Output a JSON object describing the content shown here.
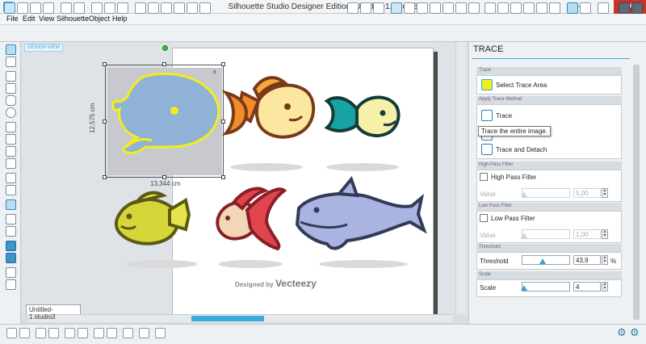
{
  "window": {
    "title": "Silhouette Studio Designer Edition: Untitled-1.studio3",
    "minimize": "–",
    "maximize": "□",
    "close": "✕"
  },
  "menu": [
    "File",
    "Edit",
    "View",
    "Silhouette",
    "Object",
    "Help"
  ],
  "canvas": {
    "design_label": "DESIGN VIEW",
    "doc_tab": "Untitled-1.studio3",
    "selection_width": "13,344 cm",
    "selection_height": "12,575 cm",
    "selection_close": "x",
    "watermark_prefix": "Designed by",
    "watermark_brand": "Vecteezy"
  },
  "panel": {
    "title": "TRACE",
    "trace_section": "Trace",
    "select_trace_area": "Select Trace Area",
    "apply_method_section": "Apply Trace Method",
    "trace": "Trace",
    "tooltip": "Trace the entire image.",
    "trace_and_detach": "Trace and Detach",
    "high_pass_section": "High Pass Filter",
    "high_pass_label": "High Pass Filter",
    "high_pass_value_label": "Value",
    "high_pass_value": "5,00",
    "low_pass_section": "Low Pass Filter",
    "low_pass_label": "Low Pass Filter",
    "low_pass_value_label": "Value",
    "low_pass_value": "1,00",
    "threshold_section": "Threshold",
    "threshold_label": "Threshold",
    "threshold_value": "43,9",
    "threshold_unit": "%",
    "threshold_level": 0.439,
    "scale_section": "Scale",
    "scale_label": "Scale",
    "scale_value": "4"
  },
  "colors": {
    "accent": "#3aa6d9",
    "close_button": "#c9332b",
    "trace_highlight": "#f2ee1a"
  }
}
